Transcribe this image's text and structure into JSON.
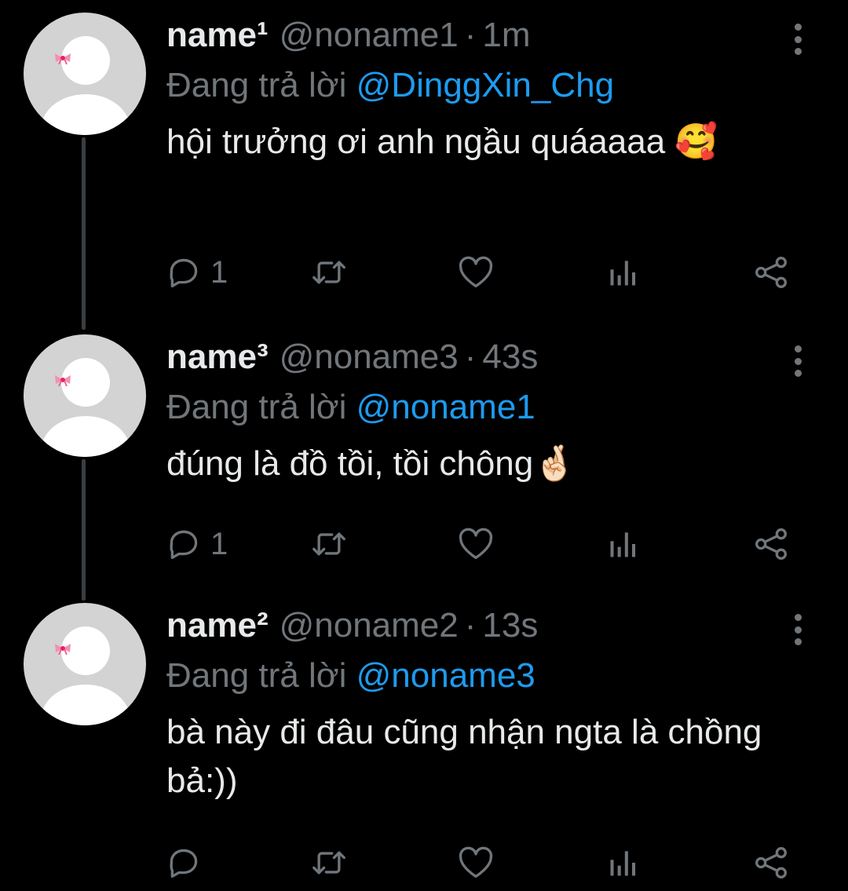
{
  "icons": {
    "reply": "reply-icon",
    "retweet": "retweet-icon",
    "like": "heart-icon",
    "views": "views-icon",
    "share": "share-icon",
    "more": "more-options-icon",
    "bow": "pink-bow-icon"
  },
  "colors": {
    "background": "#000000",
    "text": "#e7e9ea",
    "muted": "#71767b",
    "mention": "#1d9bf0"
  },
  "tweets": [
    {
      "name": "name¹",
      "handle": "@noname1",
      "separator": "·",
      "time": "1m",
      "reply_prefix": "Đang trả lời",
      "reply_to": "@DinggXin_Chg",
      "text": "hội trưởng ơi anh ngầu quáaaaa 🥰",
      "reply_count": "1"
    },
    {
      "name": "name³",
      "handle": "@noname3",
      "separator": "·",
      "time": "43s",
      "reply_prefix": "Đang trả lời",
      "reply_to": "@noname1",
      "text": "đúng là đồ tồi, tồi chông🤞🏻",
      "reply_count": "1"
    },
    {
      "name": "name²",
      "handle": "@noname2",
      "separator": "·",
      "time": "13s",
      "reply_prefix": "Đang trả lời",
      "reply_to": "@noname3",
      "text": "bà này đi đâu cũng nhận ngta là chồng bả:))",
      "reply_count": ""
    }
  ]
}
